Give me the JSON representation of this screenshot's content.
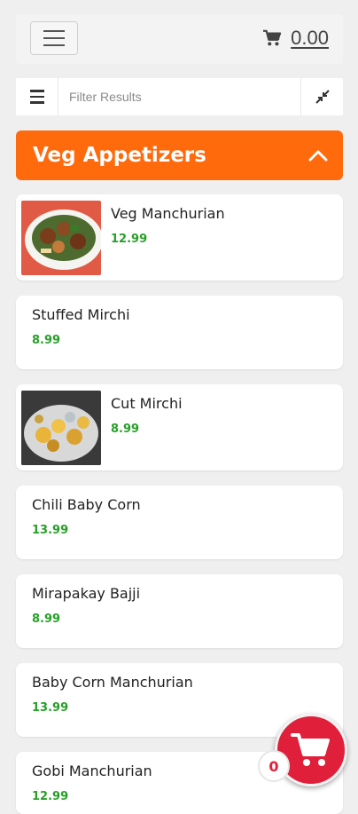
{
  "header": {
    "cart_amount": "0.00"
  },
  "filter": {
    "placeholder": "Filter Results"
  },
  "category": {
    "title": "Veg Appetizers"
  },
  "items": [
    {
      "name": "Veg Manchurian",
      "price": "12.99"
    },
    {
      "name": "Stuffed Mirchi",
      "price": "8.99"
    },
    {
      "name": "Cut Mirchi",
      "price": "8.99"
    },
    {
      "name": "Chili Baby Corn",
      "price": "13.99"
    },
    {
      "name": "Mirapakay Bajji",
      "price": "8.99"
    },
    {
      "name": "Baby Corn Manchurian",
      "price": "13.99"
    },
    {
      "name": "Gobi Manchurian",
      "price": "12.99"
    }
  ],
  "cart": {
    "count": "0"
  },
  "colors": {
    "accent": "#ff6a0d",
    "price": "#28a028",
    "fab": "#e0203a"
  }
}
